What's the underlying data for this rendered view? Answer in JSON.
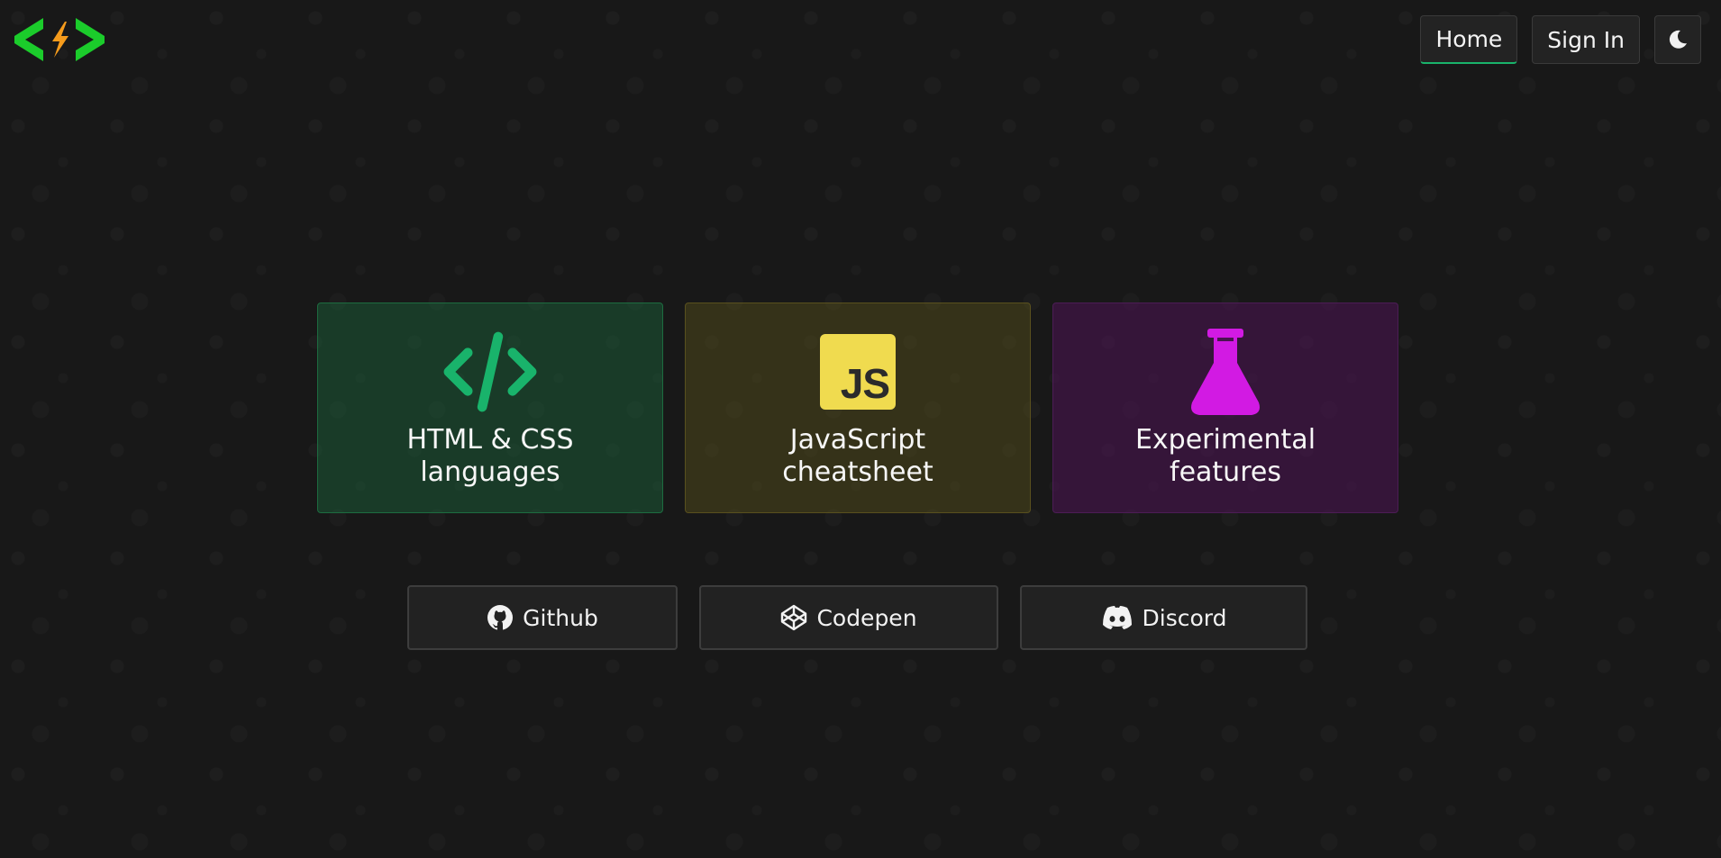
{
  "header": {
    "logo_icon": "code-bolt-logo-icon",
    "nav": {
      "home_label": "Home",
      "signin_label": "Sign In",
      "theme_icon": "moon-icon"
    }
  },
  "cards": [
    {
      "title": "HTML & CSS\nlanguages",
      "icon": "code-icon",
      "color": "#19b36b"
    },
    {
      "title": "JavaScript\ncheatsheet",
      "icon": "js-icon",
      "color": "#f0db4f",
      "icon_text": "JS"
    },
    {
      "title": "Experimental\nfeatures",
      "icon": "flask-icon",
      "color": "#d21ae3"
    }
  ],
  "links": [
    {
      "label": "Github",
      "icon": "github-icon"
    },
    {
      "label": "Codepen",
      "icon": "codepen-icon"
    },
    {
      "label": "Discord",
      "icon": "discord-icon"
    }
  ],
  "colors": {
    "background": "#181818",
    "accent": "#19b36b",
    "logo_green": "#1bcc2b",
    "logo_bolt": "#f59b1c"
  }
}
